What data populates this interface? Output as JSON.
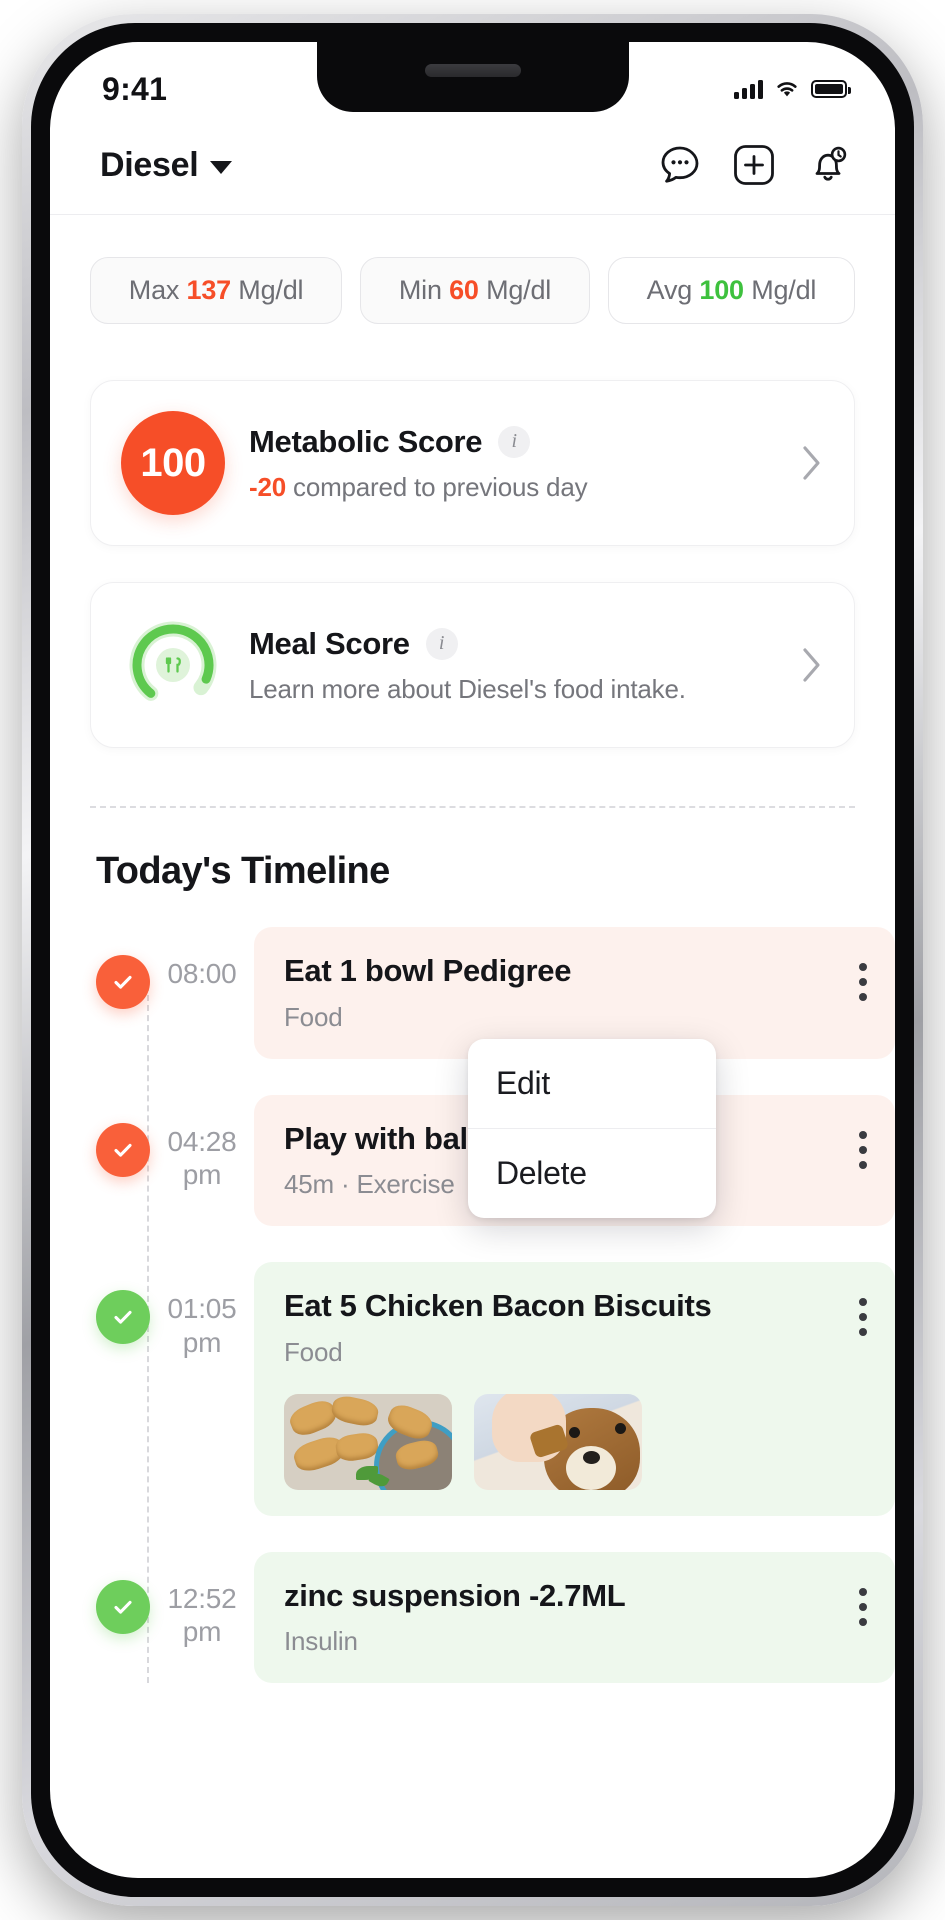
{
  "status_bar": {
    "time": "9:41",
    "signal_icon": "cellular-bars-icon",
    "wifi_icon": "wifi-icon",
    "battery_icon": "battery-full-icon"
  },
  "header": {
    "pet_name": "Diesel",
    "dropdown_icon": "chevron-down-icon",
    "actions": [
      {
        "name": "chat-icon",
        "label": "Chat"
      },
      {
        "name": "add-icon",
        "label": "Add"
      },
      {
        "name": "notification-bell-icon",
        "label": "Notifications",
        "badge": "!"
      }
    ]
  },
  "stats": [
    {
      "label": "Max",
      "value": "137",
      "unit": "Mg/dl",
      "color": "#f64e28"
    },
    {
      "label": "Min",
      "value": "60",
      "unit": "Mg/dl",
      "color": "#f64e28"
    },
    {
      "label": "Avg",
      "value": "100",
      "unit": "Mg/dl",
      "color": "#3ec13e"
    }
  ],
  "metabolic_card": {
    "score": "100",
    "title": "Metabolic Score",
    "info_glyph": "i",
    "delta": "-20",
    "delta_text": "compared to previous day",
    "chevron_icon": "chevron-right-icon"
  },
  "meal_card": {
    "title": "Meal Score",
    "info_glyph": "i",
    "subtitle": "Learn more about Diesel's food intake.",
    "gauge_icon": "cutlery-icon",
    "chevron_icon": "chevron-right-icon"
  },
  "timeline": {
    "title": "Today's Timeline",
    "items": [
      {
        "time": "08:00",
        "time_suffix": "",
        "status": "orange",
        "title": "Eat 1 bowl Pedigree",
        "meta": "Food",
        "thumbs": []
      },
      {
        "time": "04:28",
        "time_suffix": "pm",
        "status": "orange",
        "title": "Play with ball",
        "meta": "45m · Exercise",
        "thumbs": []
      },
      {
        "time": "01:05",
        "time_suffix": "pm",
        "status": "green",
        "title": "Eat 5 Chicken Bacon Biscuits",
        "meta": "Food",
        "thumbs": [
          "biscuits-photo",
          "dog-eating-biscuit-photo"
        ]
      },
      {
        "time": "12:52",
        "time_suffix": "pm",
        "status": "green",
        "title": "zinc suspension -2.7ML",
        "meta": "Insulin",
        "thumbs": []
      }
    ],
    "kebab_icon": "more-options-icon"
  },
  "context_menu": {
    "edit": "Edit",
    "delete": "Delete"
  },
  "colors": {
    "accent_orange": "#f64e28",
    "accent_green": "#3ec13e",
    "dot_orange": "#f9603a",
    "dot_green": "#6ece5c",
    "card_orange_bg": "#fdf1ed",
    "card_green_bg": "#eef8ed"
  }
}
